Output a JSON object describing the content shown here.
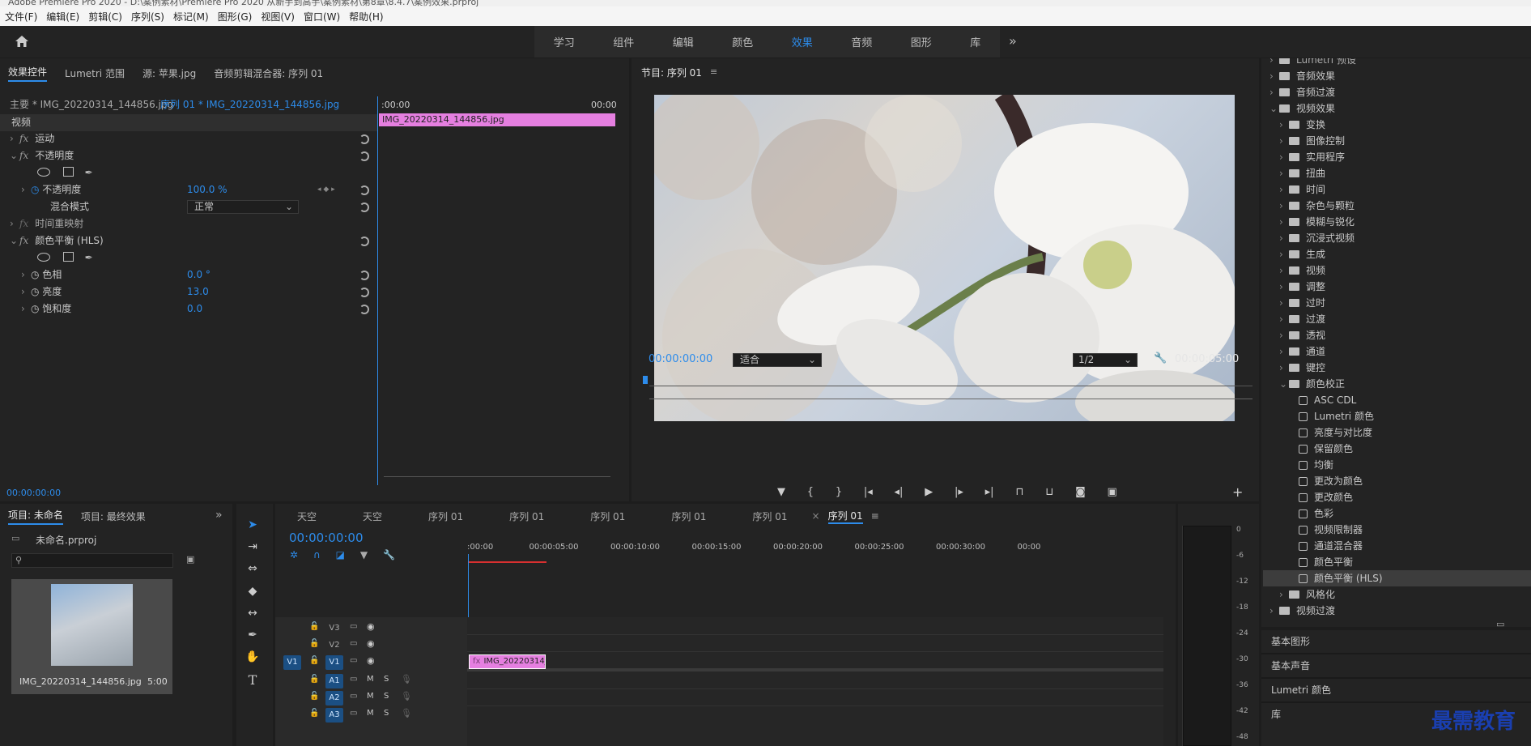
{
  "window_title": "Adobe Premiere Pro 2020 - D:\\案例素材\\Premiere Pro 2020 从新手到高手\\案例素材\\第8章\\8.4.7\\案例效果.prproj",
  "menu": [
    "文件(F)",
    "编辑(E)",
    "剪辑(C)",
    "序列(S)",
    "标记(M)",
    "图形(G)",
    "视图(V)",
    "窗口(W)",
    "帮助(H)"
  ],
  "workspaces": [
    "学习",
    "组件",
    "编辑",
    "颜色",
    "效果",
    "音频",
    "图形",
    "库"
  ],
  "active_workspace": "效果",
  "effect_controls": {
    "tabs": [
      "效果控件",
      "Lumetri 范围",
      "源: 苹果.jpg",
      "音频剪辑混合器: 序列 01"
    ],
    "master_label": "主要 * IMG_20220314_144856.jpg",
    "sequence_label": "序列 01 * IMG_20220314_144856.jpg",
    "time_start": ":00:00",
    "time_end": "00:00",
    "clip_name": "IMG_20220314_144856.jpg",
    "section_video": "视频",
    "motion": "运动",
    "opacity_group": "不透明度",
    "opacity_label": "不透明度",
    "opacity_value": "100.0 %",
    "blend_label": "混合模式",
    "blend_value": "正常",
    "time_remap": "时间重映射",
    "hls_group": "颜色平衡 (HLS)",
    "hue_label": "色相",
    "hue_value": "0.0 °",
    "lightness_label": "亮度",
    "lightness_value": "13.0",
    "saturation_label": "饱和度",
    "saturation_value": "0.0",
    "footer_time": "00:00:00:00"
  },
  "program": {
    "title": "节目: 序列 01",
    "timecode": "00:00:00:00",
    "fit": "适合",
    "resolution": "1/2",
    "duration": "00:00:05:00"
  },
  "project": {
    "tabs": [
      "项目: 未命名",
      "项目: 最终效果"
    ],
    "file": "未命名.prproj",
    "item_name": "IMG_20220314_144856.jpg",
    "item_duration": "5:00"
  },
  "timeline": {
    "tabs": [
      "天空",
      "天空",
      "序列 01",
      "序列 01",
      "序列 01",
      "序列 01",
      "序列 01",
      "序列 01"
    ],
    "timecode": "00:00:00:00",
    "ruler": [
      ":00:00",
      "00:00:05:00",
      "00:00:10:00",
      "00:00:15:00",
      "00:00:20:00",
      "00:00:25:00",
      "00:00:30:00",
      "00:00"
    ],
    "video_tracks": [
      "V3",
      "V2",
      "V1"
    ],
    "audio_tracks": [
      "A1",
      "A2",
      "A3"
    ],
    "src_label": "V1",
    "clip": "IMG_20220314_144",
    "m": "M",
    "s": "S"
  },
  "meters": [
    "0",
    "-6",
    "-12",
    "-18",
    "-24",
    "-30",
    "-36",
    "-42",
    "-48"
  ],
  "effects_panel": {
    "top_partial": "Lumetri 预设",
    "items": [
      {
        "label": "音频效果",
        "level": 0,
        "type": "folder"
      },
      {
        "label": "音频过渡",
        "level": 0,
        "type": "folder"
      },
      {
        "label": "视频效果",
        "level": 0,
        "type": "folder",
        "open": true
      },
      {
        "label": "变换",
        "level": 1,
        "type": "folder"
      },
      {
        "label": "图像控制",
        "level": 1,
        "type": "folder"
      },
      {
        "label": "实用程序",
        "level": 1,
        "type": "folder"
      },
      {
        "label": "扭曲",
        "level": 1,
        "type": "folder"
      },
      {
        "label": "时间",
        "level": 1,
        "type": "folder"
      },
      {
        "label": "杂色与颗粒",
        "level": 1,
        "type": "folder"
      },
      {
        "label": "模糊与锐化",
        "level": 1,
        "type": "folder"
      },
      {
        "label": "沉浸式视频",
        "level": 1,
        "type": "folder"
      },
      {
        "label": "生成",
        "level": 1,
        "type": "folder"
      },
      {
        "label": "视频",
        "level": 1,
        "type": "folder"
      },
      {
        "label": "调整",
        "level": 1,
        "type": "folder"
      },
      {
        "label": "过时",
        "level": 1,
        "type": "folder"
      },
      {
        "label": "过渡",
        "level": 1,
        "type": "folder"
      },
      {
        "label": "透视",
        "level": 1,
        "type": "folder"
      },
      {
        "label": "通道",
        "level": 1,
        "type": "folder"
      },
      {
        "label": "键控",
        "level": 1,
        "type": "folder"
      },
      {
        "label": "颜色校正",
        "level": 1,
        "type": "folder",
        "open": true
      },
      {
        "label": "ASC CDL",
        "level": 2,
        "type": "preset"
      },
      {
        "label": "Lumetri 颜色",
        "level": 2,
        "type": "preset"
      },
      {
        "label": "亮度与对比度",
        "level": 2,
        "type": "preset"
      },
      {
        "label": "保留颜色",
        "level": 2,
        "type": "preset"
      },
      {
        "label": "均衡",
        "level": 2,
        "type": "preset"
      },
      {
        "label": "更改为颜色",
        "level": 2,
        "type": "preset"
      },
      {
        "label": "更改颜色",
        "level": 2,
        "type": "preset"
      },
      {
        "label": "色彩",
        "level": 2,
        "type": "preset"
      },
      {
        "label": "视频限制器",
        "level": 2,
        "type": "preset"
      },
      {
        "label": "通道混合器",
        "level": 2,
        "type": "preset"
      },
      {
        "label": "颜色平衡",
        "level": 2,
        "type": "preset"
      },
      {
        "label": "颜色平衡 (HLS)",
        "level": 2,
        "type": "preset",
        "selected": true
      },
      {
        "label": "风格化",
        "level": 1,
        "type": "folder"
      },
      {
        "label": "视频过渡",
        "level": 0,
        "type": "folder"
      }
    ],
    "bottom_panels": [
      "基本图形",
      "基本声音",
      "Lumetri 颜色",
      "库"
    ]
  },
  "watermark": "最需教育"
}
